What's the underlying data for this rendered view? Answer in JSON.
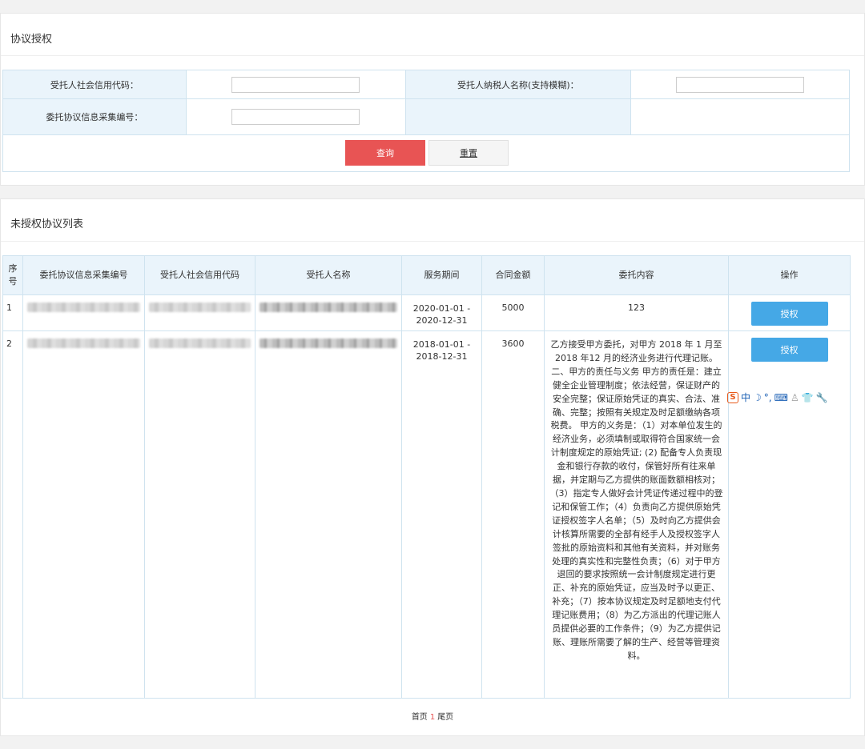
{
  "search_panel": {
    "title": "协议授权",
    "fields": {
      "credit_code_label": "受托人社会信用代码：",
      "taxpayer_name_label": "受托人纳税人名称(支持模糊)：",
      "agreement_no_label": "委托协议信息采集编号：",
      "credit_code_value": "",
      "taxpayer_name_value": "",
      "agreement_no_value": ""
    },
    "query_label": "查询",
    "reset_label": "重置"
  },
  "list_panel": {
    "title": "未授权协议列表",
    "columns": [
      "序号",
      "委托协议信息采集编号",
      "受托人社会信用代码",
      "受托人名称",
      "服务期间",
      "合同金额",
      "委托内容",
      "操作"
    ],
    "rows": [
      {
        "index": "1",
        "agreement_no": "",
        "credit_code": "",
        "name": "",
        "period_start": "2020-01-01 -",
        "period_end": "2020-12-31",
        "amount": "5000",
        "content": "123",
        "action": "授权"
      },
      {
        "index": "2",
        "agreement_no": "",
        "credit_code": "",
        "name": "",
        "period_start": "2018-01-01 -",
        "period_end": "2018-12-31",
        "amount": "3600",
        "content": "乙方接受甲方委托，对甲方 2018 年 1 月至 2018 年12 月的经济业务进行代理记账。二、甲方的责任与义务 甲方的责任是：建立健全企业管理制度；依法经营，保证财产的安全完整；保证原始凭证的真实、合法、准确、完整；按照有关规定及时足额缴纳各项税费。 甲方的义务是：（1）对本单位发生的经济业务，必须填制或取得符合国家统一会计制度规定的原始凭证; (2) 配备专人负责现金和银行存款的收付，保管好所有往来单据，并定期与乙方提供的账面数额相核对；（3）指定专人做好会计凭证传递过程中的登记和保管工作；（4）负责向乙方提供原始凭证授权签字人名单；（5）及时向乙方提供会计核算所需要的全部有经手人及授权签字人签批的原始资料和其他有关资料，并对账务处理的真实性和完整性负责；（6）对于甲方退回的要求按照统一会计制度规定进行更正、补充的原始凭证，应当及时予以更正、补充；（7）按本协议规定及时足额地支付代理记账费用；（8）为乙方派出的代理记账人员提供必要的工作条件；（9）为乙方提供记账、理账所需要了解的生产、经营等管理资料。",
        "action": "授权"
      }
    ],
    "pager": {
      "first": "首页",
      "current": "1",
      "last": "尾页"
    }
  },
  "ime_toolbar": {
    "icons": [
      "sogou-logo-icon",
      "chinese-mode-icon",
      "moon-icon",
      "punctuation-icon",
      "keyboard-icon",
      "user-icon",
      "skin-icon",
      "tools-icon"
    ],
    "mode_label": "中"
  },
  "colors": {
    "query_button": "#e85454",
    "auth_button": "#45a8e6",
    "header_bg": "#eaf4fb"
  }
}
